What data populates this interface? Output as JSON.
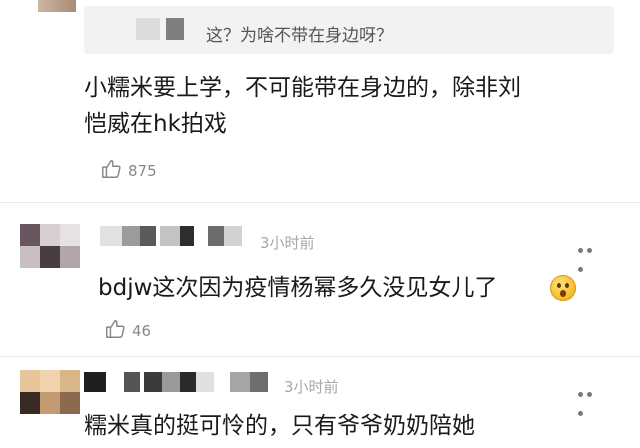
{
  "reply_quote": {
    "text": "这？为啥不带在身边呀？"
  },
  "comments": [
    {
      "text_line1": "小糯米要上学，不可能带在身边的，除非刘",
      "text_line2": "恺威在hk拍戏",
      "likes": "875"
    },
    {
      "time": "3小时前",
      "text": "bdjw这次因为疫情杨幂多久没见女儿了",
      "emoji": "astonished-face",
      "likes": "46"
    },
    {
      "time": "3小时前",
      "text": "糯米真的挺可怜的，只有爷爷奶奶陪她"
    }
  ],
  "colors": {
    "quote_bg": "#f2f2f2",
    "time_gray": "#a8a8a8",
    "text": "#1a1a1a"
  }
}
